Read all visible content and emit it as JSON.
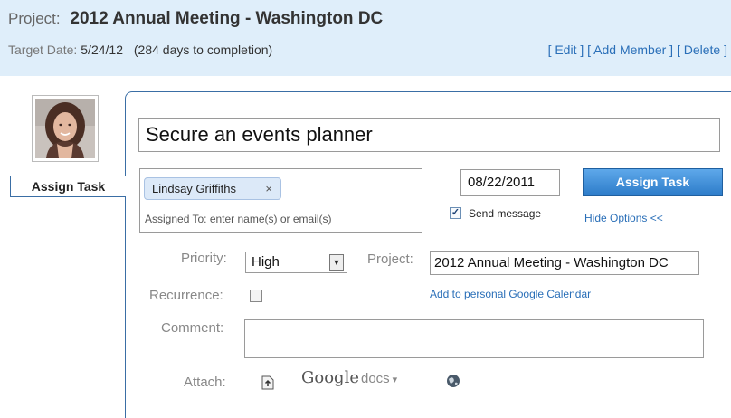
{
  "header": {
    "project_label": "Project:",
    "project_name": "2012 Annual Meeting - Washington DC",
    "target_label": "Target Date:",
    "target_date": "5/24/12",
    "days_to_completion": "(284 days to completion)",
    "actions": {
      "edit": "[ Edit ]",
      "add_member": "[ Add Member ]",
      "delete": "[ Delete ]"
    }
  },
  "sidebar": {
    "avatar": "user-photo",
    "assign_tab_label": "Assign Task"
  },
  "task": {
    "title": "Secure an events planner",
    "assignee_chip": "Lindsay Griffiths",
    "assignee_remove_icon": "×",
    "assigned_to_placeholder": "Assigned To: enter name(s) or email(s)",
    "due_date": "08/22/2011",
    "assign_button": "Assign Task",
    "send_message_checked": true,
    "send_message_label": "Send message",
    "hide_options": "Hide Options <<",
    "priority_label": "Priority:",
    "priority_value": "High",
    "project_label": "Project:",
    "project_value": "2012 Annual Meeting - Washington DC",
    "google_calendar_link": "Add to personal Google Calendar",
    "recurrence_label": "Recurrence:",
    "recurrence_checked": false,
    "comment_label": "Comment:",
    "comment_value": "",
    "attach_label": "Attach:",
    "google_docs_brand": "Google",
    "google_docs_product": "docs",
    "icons": [
      "file-upload-icon",
      "google-docs-dropdown-icon",
      "globe-icon"
    ]
  },
  "colors": {
    "header_bg": "#dfeefa",
    "link": "#2a6fb8",
    "button_bg": "#2d7cc9",
    "chip_bg": "#dce9f8",
    "panel_border": "#3a6ea5"
  }
}
